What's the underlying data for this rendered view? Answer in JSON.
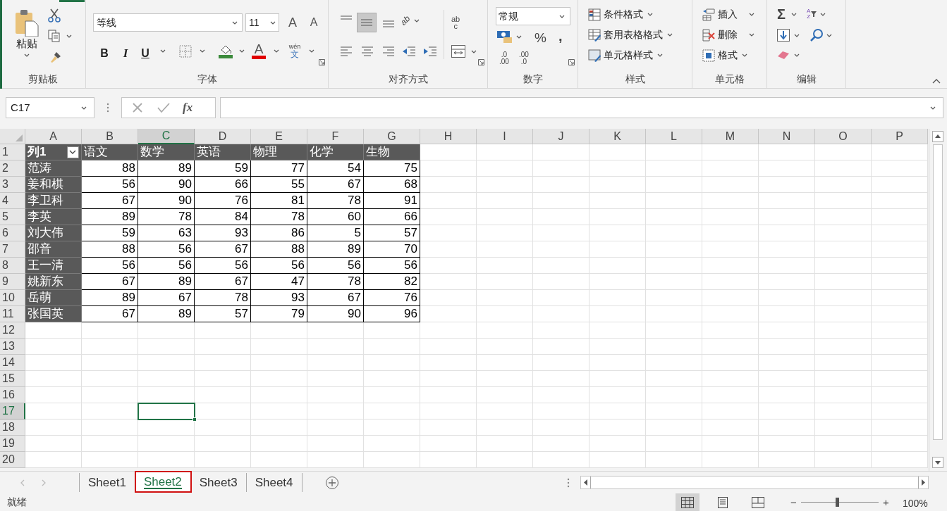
{
  "ribbon": {
    "groups": [
      {
        "kind": "clipboard",
        "label": "剪贴板",
        "paste": "粘贴"
      },
      {
        "kind": "font",
        "label": "字体",
        "font_name": "等线",
        "font_size": "11",
        "grow": "A",
        "shrink": "A",
        "bold": "B",
        "italic": "I",
        "underline": "U",
        "font_color": "A",
        "phonetic": "wén",
        "phonetic_char": "文"
      },
      {
        "kind": "alignment",
        "label": "对齐方式",
        "orientation": "ab",
        "wrap": "ab",
        "wrap_second": "c"
      },
      {
        "kind": "number",
        "label": "数字",
        "format": "常规",
        "percent": "%",
        "comma": ",",
        "increase_decimal": [
          ".0",
          ".00"
        ],
        "decrease_decimal": [
          ".00",
          ".0"
        ]
      },
      {
        "kind": "styles",
        "label": "样式",
        "buttons": [
          "条件格式",
          "套用表格格式",
          "单元格样式"
        ]
      },
      {
        "kind": "cells",
        "label": "单元格",
        "buttons": [
          "插入",
          "删除",
          "格式"
        ]
      },
      {
        "kind": "editing",
        "label": "编辑",
        "sum": "Σ",
        "sort": "A",
        "sort_second": "Z"
      }
    ]
  },
  "formula_bar": {
    "name_box": "C17",
    "function": "fx"
  },
  "sheet": {
    "columns": [
      {
        "label": "A",
        "selected": false
      },
      {
        "label": "B",
        "selected": false
      },
      {
        "label": "C",
        "selected": true
      },
      {
        "label": "D",
        "selected": false
      },
      {
        "label": "E",
        "selected": false
      },
      {
        "label": "F",
        "selected": false
      },
      {
        "label": "G",
        "selected": false
      },
      {
        "label": "H",
        "selected": false
      },
      {
        "label": "I",
        "selected": false
      },
      {
        "label": "J",
        "selected": false
      },
      {
        "label": "K",
        "selected": false
      },
      {
        "label": "L",
        "selected": false
      },
      {
        "label": "M",
        "selected": false
      },
      {
        "label": "N",
        "selected": false
      },
      {
        "label": "O",
        "selected": false
      },
      {
        "label": "P",
        "selected": false
      }
    ],
    "rows": [
      {
        "label": "1",
        "selected": false
      },
      {
        "label": "2",
        "selected": false
      },
      {
        "label": "3",
        "selected": false
      },
      {
        "label": "4",
        "selected": false
      },
      {
        "label": "5",
        "selected": false
      },
      {
        "label": "6",
        "selected": false
      },
      {
        "label": "7",
        "selected": false
      },
      {
        "label": "8",
        "selected": false
      },
      {
        "label": "9",
        "selected": false
      },
      {
        "label": "10",
        "selected": false
      },
      {
        "label": "11",
        "selected": false
      },
      {
        "label": "12",
        "selected": false
      },
      {
        "label": "13",
        "selected": false
      },
      {
        "label": "14",
        "selected": false
      },
      {
        "label": "15",
        "selected": false
      },
      {
        "label": "16",
        "selected": false
      },
      {
        "label": "17",
        "selected": true
      },
      {
        "label": "18",
        "selected": false
      },
      {
        "label": "19",
        "selected": false
      },
      {
        "label": "20",
        "selected": false
      }
    ],
    "table": {
      "header": [
        "列1",
        "语文",
        "数学",
        "英语",
        "物理",
        "化学",
        "生物"
      ],
      "rows": [
        [
          "范涛",
          "88",
          "89",
          "59",
          "77",
          "54",
          "75"
        ],
        [
          "姜和棋",
          "56",
          "90",
          "66",
          "55",
          "67",
          "68"
        ],
        [
          "李卫科",
          "67",
          "90",
          "76",
          "81",
          "78",
          "91"
        ],
        [
          "李英",
          "89",
          "78",
          "84",
          "78",
          "60",
          "66"
        ],
        [
          "刘大伟",
          "59",
          "63",
          "93",
          "86",
          "5",
          "57"
        ],
        [
          "邵音",
          "88",
          "56",
          "67",
          "88",
          "89",
          "70"
        ],
        [
          "王一清",
          "56",
          "56",
          "56",
          "56",
          "56",
          "56"
        ],
        [
          "姚新东",
          "67",
          "89",
          "67",
          "47",
          "78",
          "82"
        ],
        [
          "岳萌",
          "89",
          "67",
          "78",
          "93",
          "67",
          "76"
        ],
        [
          "张国英",
          "67",
          "89",
          "57",
          "79",
          "90",
          "96"
        ]
      ]
    }
  },
  "sheet_tabs": [
    {
      "label": "Sheet1",
      "selected": false,
      "outlined": false
    },
    {
      "label": "Sheet2",
      "selected": true,
      "outlined": true
    },
    {
      "label": "Sheet3",
      "selected": false,
      "outlined": false
    },
    {
      "label": "Sheet4",
      "selected": false,
      "outlined": false
    }
  ],
  "status_bar": {
    "text": "就绪",
    "views": [
      {
        "kind": "normal",
        "selected": true
      },
      {
        "kind": "page_layout",
        "selected": false
      },
      {
        "kind": "page_break",
        "selected": false
      }
    ],
    "zoom": {
      "level": 0.46,
      "minus": "−",
      "plus": "+",
      "reading": "100%"
    }
  }
}
